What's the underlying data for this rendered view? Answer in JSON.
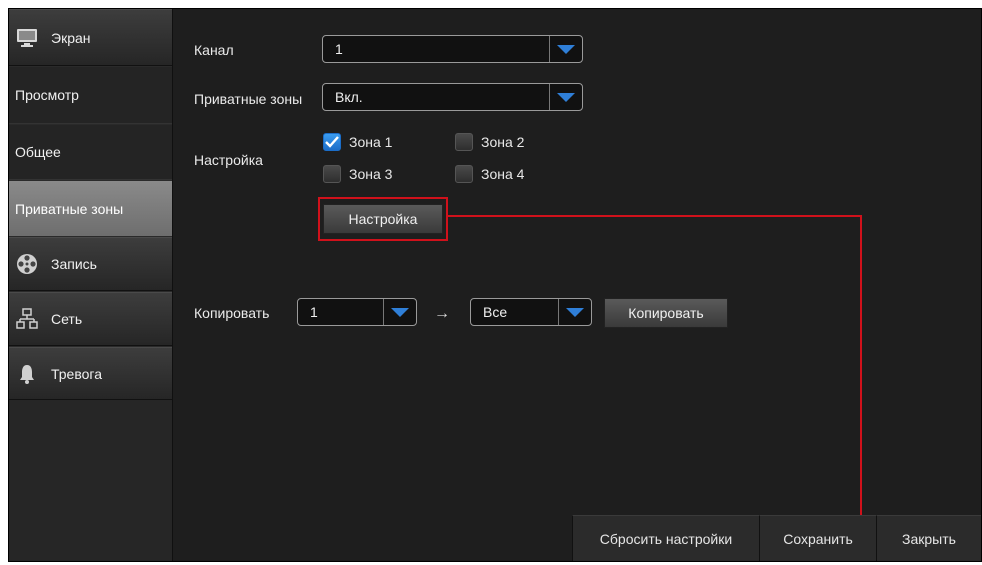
{
  "sidebar": {
    "items": [
      {
        "label": "Экран",
        "icon": "monitor-icon",
        "kind": "category"
      },
      {
        "label": "Просмотр",
        "kind": "sub"
      },
      {
        "label": "Общее",
        "kind": "sub"
      },
      {
        "label": "Приватные зоны",
        "kind": "sub",
        "active": true
      },
      {
        "label": "Запись",
        "icon": "film-reel-icon",
        "kind": "category"
      },
      {
        "label": "Сеть",
        "icon": "network-icon",
        "kind": "category"
      },
      {
        "label": "Тревога",
        "icon": "bell-icon",
        "kind": "category"
      }
    ]
  },
  "form": {
    "channel_label": "Канал",
    "channel_value": "1",
    "privacy_label": "Приватные зоны",
    "privacy_value": "Вкл.",
    "setup_label": "Настройка",
    "zones": [
      {
        "label": "Зона 1",
        "checked": true
      },
      {
        "label": "Зона 2",
        "checked": false
      },
      {
        "label": "Зона 3",
        "checked": false
      },
      {
        "label": "Зона 4",
        "checked": false
      }
    ],
    "setup_button": "Настройка",
    "copy_label": "Копировать",
    "copy_from": "1",
    "copy_arrow": "→",
    "copy_to": "Все",
    "copy_button": "Копировать"
  },
  "footer": {
    "reset": "Сбросить настройки",
    "save": "Сохранить",
    "close": "Закрыть"
  },
  "colors": {
    "accent": "#2f7fd8",
    "highlight": "#d0111b",
    "active_nav": "#7c7c7c"
  }
}
